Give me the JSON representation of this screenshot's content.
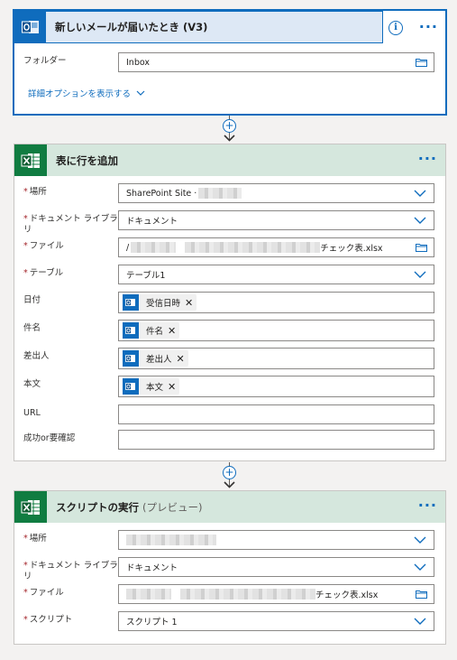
{
  "trigger": {
    "title": "新しいメールが届いたとき (V3)",
    "icon": "outlook-icon",
    "info_label": "i",
    "more_label": "···",
    "folder_label": "フォルダー",
    "folder_value": "Inbox",
    "advanced_label": "詳細オプションを表示する"
  },
  "add_row": {
    "title": "表に行を追加",
    "icon": "excel-icon",
    "more_label": "···",
    "fields": {
      "location_label": "場所",
      "location_value": "SharePoint Site ·",
      "library_label": "ドキュメント ライブラリ",
      "library_value": "ドキュメント",
      "file_label": "ファイル",
      "file_prefix": "/",
      "file_value": "チェック表.xlsx",
      "table_label": "テーブル",
      "table_value": "テーブル1",
      "date_label": "日付",
      "date_token": "受信日時",
      "subject_label": "件名",
      "subject_token": "件名",
      "from_label": "差出人",
      "from_token": "差出人",
      "body_label": "本文",
      "body_token": "本文",
      "url_label": "URL",
      "url_value": "",
      "status_label": "成功or要確認",
      "status_value": ""
    },
    "token_remove": "✕"
  },
  "run_script": {
    "title": "スクリプトの実行",
    "subtitle": "(プレビュー)",
    "icon": "excel-icon",
    "more_label": "···",
    "fields": {
      "location_label": "場所",
      "library_label": "ドキュメント ライブラリ",
      "library_value": "ドキュメント",
      "file_label": "ファイル",
      "file_value": "チェック表.xlsx",
      "script_label": "スクリプト",
      "script_value": "スクリプト 1"
    }
  },
  "colors": {
    "accent": "#0f6cbd",
    "outlook": "#0f6cbd",
    "excel": "#107c41",
    "excel_header": "#d5e7dd",
    "trigger_header": "#dde8f5",
    "required": "#a4262c"
  }
}
